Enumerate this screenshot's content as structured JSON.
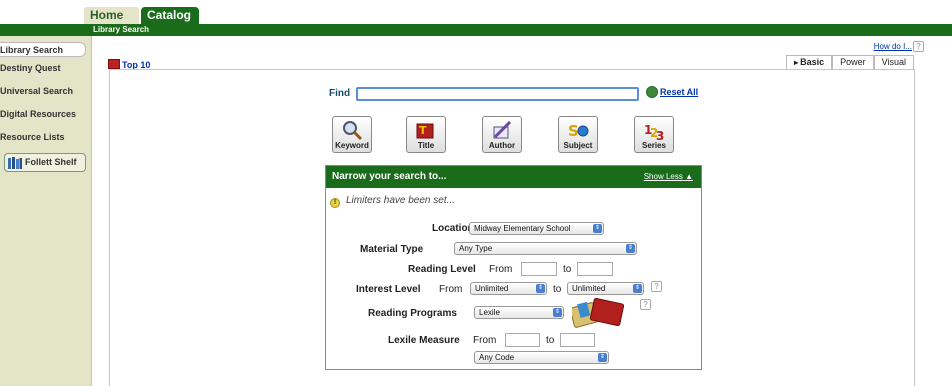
{
  "nav": {
    "tabs": [
      {
        "label": "Home"
      },
      {
        "label": "Catalog"
      }
    ],
    "subtab": "Library Search"
  },
  "sidebar": {
    "items": [
      {
        "label": "Library Search"
      },
      {
        "label": "Destiny Quest"
      },
      {
        "label": "Universal Search"
      },
      {
        "label": "Digital Resources"
      },
      {
        "label": "Resource Lists"
      }
    ],
    "follett_label": "Follett Shelf"
  },
  "header": {
    "top10": "Top 10",
    "how_do_i": "How do I...",
    "help": "?",
    "modes": [
      {
        "label": "Basic"
      },
      {
        "label": "Power"
      },
      {
        "label": "Visual"
      }
    ]
  },
  "search": {
    "find_label": "Find",
    "find_value": "",
    "reset_label": "Reset All",
    "buttons": [
      {
        "label": "Keyword"
      },
      {
        "label": "Title"
      },
      {
        "label": "Author"
      },
      {
        "label": "Subject"
      },
      {
        "label": "Series"
      }
    ]
  },
  "narrow": {
    "title": "Narrow your search to...",
    "show_less": "Show Less",
    "limiters_note": "Limiters have been set...",
    "location_label": "Location",
    "location_value": "Midway Elementary School",
    "material_label": "Material Type",
    "material_value": "Any Type",
    "reading_level_label": "Reading Level",
    "from": "From",
    "to": "to",
    "interest_label": "Interest Level",
    "interest_from_value": "Unlimited",
    "interest_to_value": "Unlimited",
    "programs_label": "Reading Programs",
    "programs_value": "Lexile",
    "lexile_label": "Lexile Measure",
    "code_value": "Any Code"
  },
  "colors": {
    "nav_green": "#1a6b1a",
    "sidebar_bg": "#e4e4c8",
    "link_blue": "#0033aa"
  }
}
